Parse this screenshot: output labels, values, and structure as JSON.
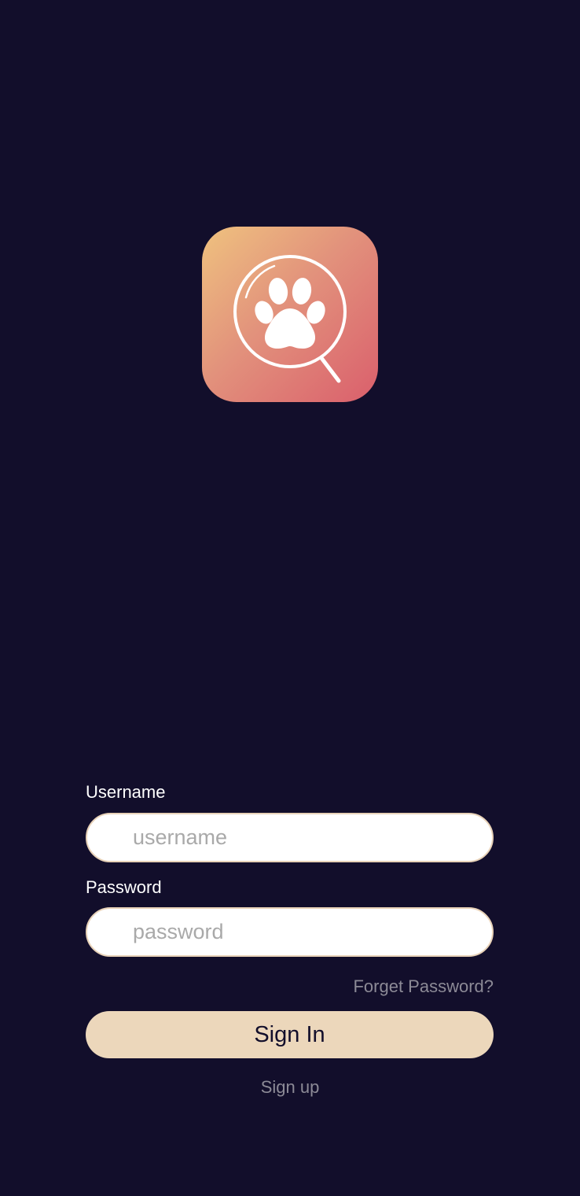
{
  "logo": {
    "icon": "paw-magnifier-icon",
    "gradient": [
      "#efc27f",
      "#e2927c",
      "#da5f6c"
    ]
  },
  "form": {
    "username": {
      "label": "Username",
      "placeholder": "username",
      "value": ""
    },
    "password": {
      "label": "Password",
      "placeholder": "password",
      "value": ""
    },
    "forgot_password": "Forget Password?",
    "sign_in": "Sign In",
    "sign_up": "Sign up"
  },
  "colors": {
    "background": "#120e2b",
    "button": "#ecd7bb",
    "link": "#8c8a96"
  }
}
